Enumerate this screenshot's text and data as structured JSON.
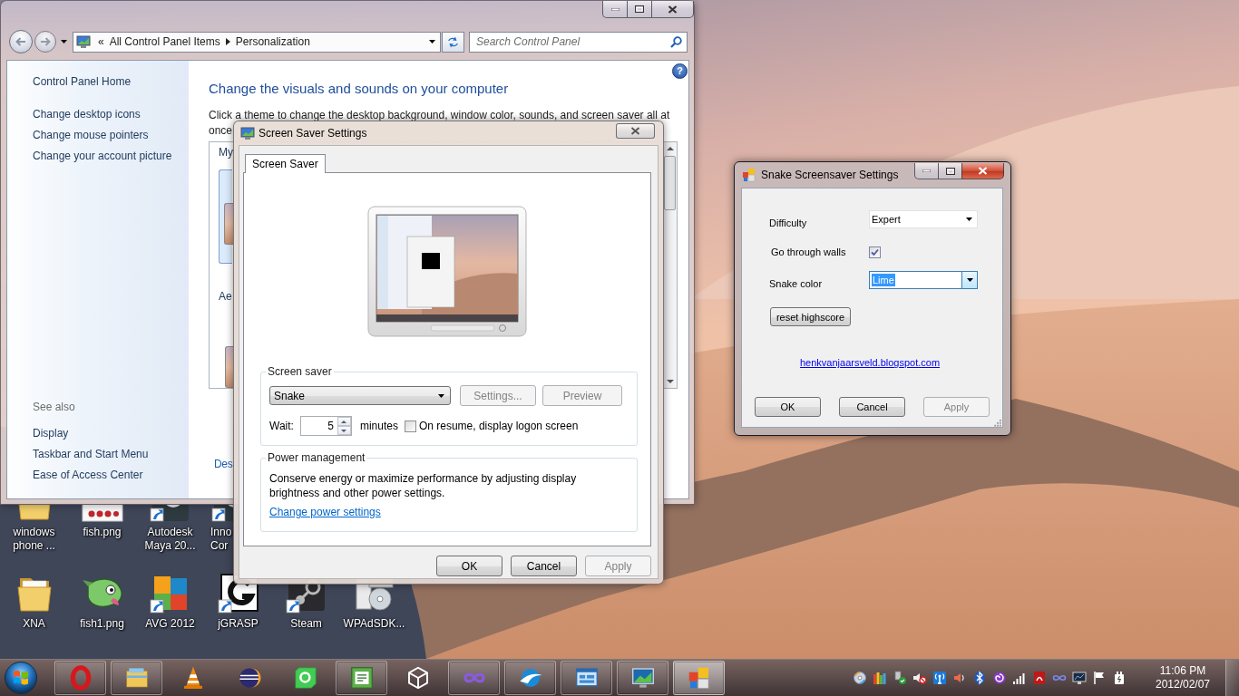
{
  "control_panel": {
    "active": false,
    "address_bar": {
      "overflow": "«",
      "breadcrumbs": [
        "All Control Panel Items",
        "Personalization"
      ]
    },
    "search": {
      "placeholder": "Search Control Panel"
    },
    "help_button": "?",
    "sidebar": {
      "home": "Control Panel Home",
      "tasks": [
        "Change desktop icons",
        "Change mouse pointers",
        "Change your account picture"
      ],
      "see_also_heading": "See also",
      "see_also": [
        "Display",
        "Taskbar and Start Menu",
        "Ease of Access Center"
      ]
    },
    "heading": "Change the visuals and sounds on your computer",
    "description_lines": [
      "Click a theme to change the desktop background, window color, sounds, and screen saver all at",
      "once"
    ],
    "theme_groups": [
      {
        "label": "My",
        "themes": [
          {
            "selected": true
          }
        ]
      },
      {
        "label": "Ae",
        "themes": [
          {
            "selected": false
          }
        ]
      }
    ],
    "bottom_link": "Des"
  },
  "screen_saver_dialog": {
    "title": "Screen Saver Settings",
    "active": false,
    "tabs": [
      {
        "label": "Screen Saver",
        "selected": true
      }
    ],
    "screen_saver": {
      "legend": "Screen saver",
      "value": "Snake",
      "buttons": [
        {
          "label": "Settings...",
          "disabled": true
        },
        {
          "label": "Preview",
          "disabled": true
        }
      ],
      "wait_label": "Wait:",
      "wait_value": "5",
      "wait_unit": "minutes",
      "logon": {
        "label": "On resume, display logon screen",
        "checked": false
      }
    },
    "power": {
      "legend": "Power management",
      "text": "Conserve energy or maximize performance by adjusting display brightness and other power settings.",
      "link": "Change power settings"
    },
    "buttons": [
      {
        "label": "OK",
        "disabled": false
      },
      {
        "label": "Cancel",
        "disabled": false
      },
      {
        "label": "Apply",
        "disabled": true
      }
    ]
  },
  "snake_window": {
    "title": "Snake Screensaver Settings",
    "active": true,
    "fields": [
      {
        "kind": "dropdown",
        "label": "Difficulty",
        "value": "Expert",
        "focused": false
      },
      {
        "kind": "checkbox",
        "label": "Go through walls",
        "checked": true
      },
      {
        "kind": "dropdown",
        "label": "Snake color",
        "value": "Lime",
        "focused": true
      }
    ],
    "reset_button": "reset highscore",
    "link": "henkvanjaarsveld.blogspot.com",
    "buttons": [
      {
        "label": "OK",
        "disabled": false
      },
      {
        "label": "Cancel",
        "disabled": false
      },
      {
        "label": "Apply",
        "disabled": true
      }
    ]
  },
  "desktop_icons": [
    [
      {
        "label": "windows phone ...",
        "kind": "folder",
        "shortcut": false
      },
      {
        "label": "fish.png",
        "kind": "sprites",
        "shortcut": false
      },
      {
        "label": "Autodesk Maya 20...",
        "kind": "app",
        "shortcut": true
      },
      {
        "label": "Inno Cor",
        "kind": "app",
        "shortcut": true
      }
    ],
    [
      {
        "label": "XNA",
        "kind": "folder",
        "shortcut": false
      },
      {
        "label": "fish1.png",
        "kind": "fish",
        "shortcut": false
      },
      {
        "label": "AVG 2012",
        "kind": "tiles",
        "shortcut": true
      },
      {
        "label": "jGRASP",
        "kind": "arc",
        "shortcut": true
      },
      {
        "label": "Steam",
        "kind": "steam",
        "shortcut": true
      },
      {
        "label": "WPAdSDK...",
        "kind": "disc",
        "shortcut": false
      }
    ]
  ],
  "taskbar": {
    "apps": [
      {
        "kind": "ring",
        "running": true,
        "selected": false
      },
      {
        "kind": "folder",
        "running": true,
        "selected": false
      },
      {
        "kind": "cone",
        "running": false,
        "selected": false
      },
      {
        "kind": "sphere",
        "running": false,
        "selected": false
      },
      {
        "kind": "tilering",
        "running": false,
        "selected": false
      },
      {
        "kind": "doctile",
        "running": true,
        "selected": false
      },
      {
        "kind": "cube",
        "running": false,
        "selected": false
      },
      {
        "kind": "infinity",
        "running": true,
        "selected": false
      },
      {
        "kind": "swoosh",
        "running": true,
        "selected": false
      },
      {
        "kind": "panel",
        "running": true,
        "selected": false
      },
      {
        "kind": "monitor",
        "running": true,
        "selected": false
      },
      {
        "kind": "squares",
        "running": true,
        "selected": true
      }
    ],
    "clock": {
      "time": "11:06 PM",
      "date": "2012/02/07"
    }
  }
}
